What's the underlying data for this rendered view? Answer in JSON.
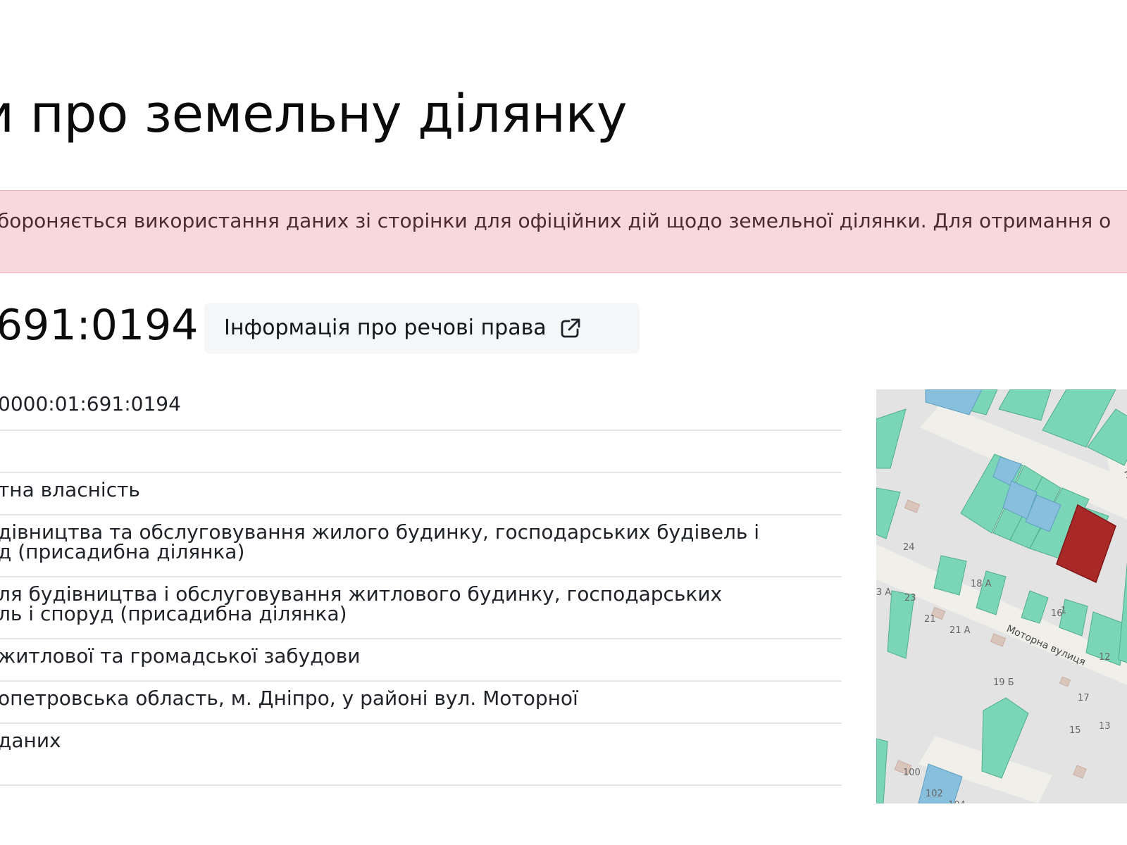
{
  "header": {
    "title": "и про земельну ділянку"
  },
  "warning": {
    "text": "бороняється використання даних зі сторінки для офіційних дій щодо земельної ділянки. Для отримання о"
  },
  "parcel": {
    "cadastral_short": "691:0194",
    "rights_button": {
      "label": "Інформація про речові права",
      "icon": "external-link-icon"
    }
  },
  "info": {
    "rows": [
      "0000:01:691:0194",
      "",
      "тна власність",
      "дівництва та обслуговування жилого будинку, господарських будівель і\nд (присадибна ділянка)",
      "ля будівництва і обслуговування житлового будинку, господарських\nль і споруд (присадибна ділянка)",
      "житлової та громадської забудови",
      "опетровська область, м. Дніпро, у районі вул. Моторної",
      "даних"
    ]
  },
  "map": {
    "street_name": "Моторна вулиця",
    "street_partial": "Мо",
    "labels": [
      "24",
      "23",
      "21",
      "21 А",
      "3 А",
      "18 А",
      "16",
      "12",
      "19 Б",
      "17",
      "15",
      "13",
      "100",
      "102",
      "104",
      "1"
    ],
    "colors": {
      "background": "#e3e3e3",
      "road": "#f1efea",
      "parcel_green": "#7bd6b7",
      "parcel_blue": "#87bfdc",
      "selected_parcel": "#a92828",
      "building": "#d9c5bc"
    }
  }
}
